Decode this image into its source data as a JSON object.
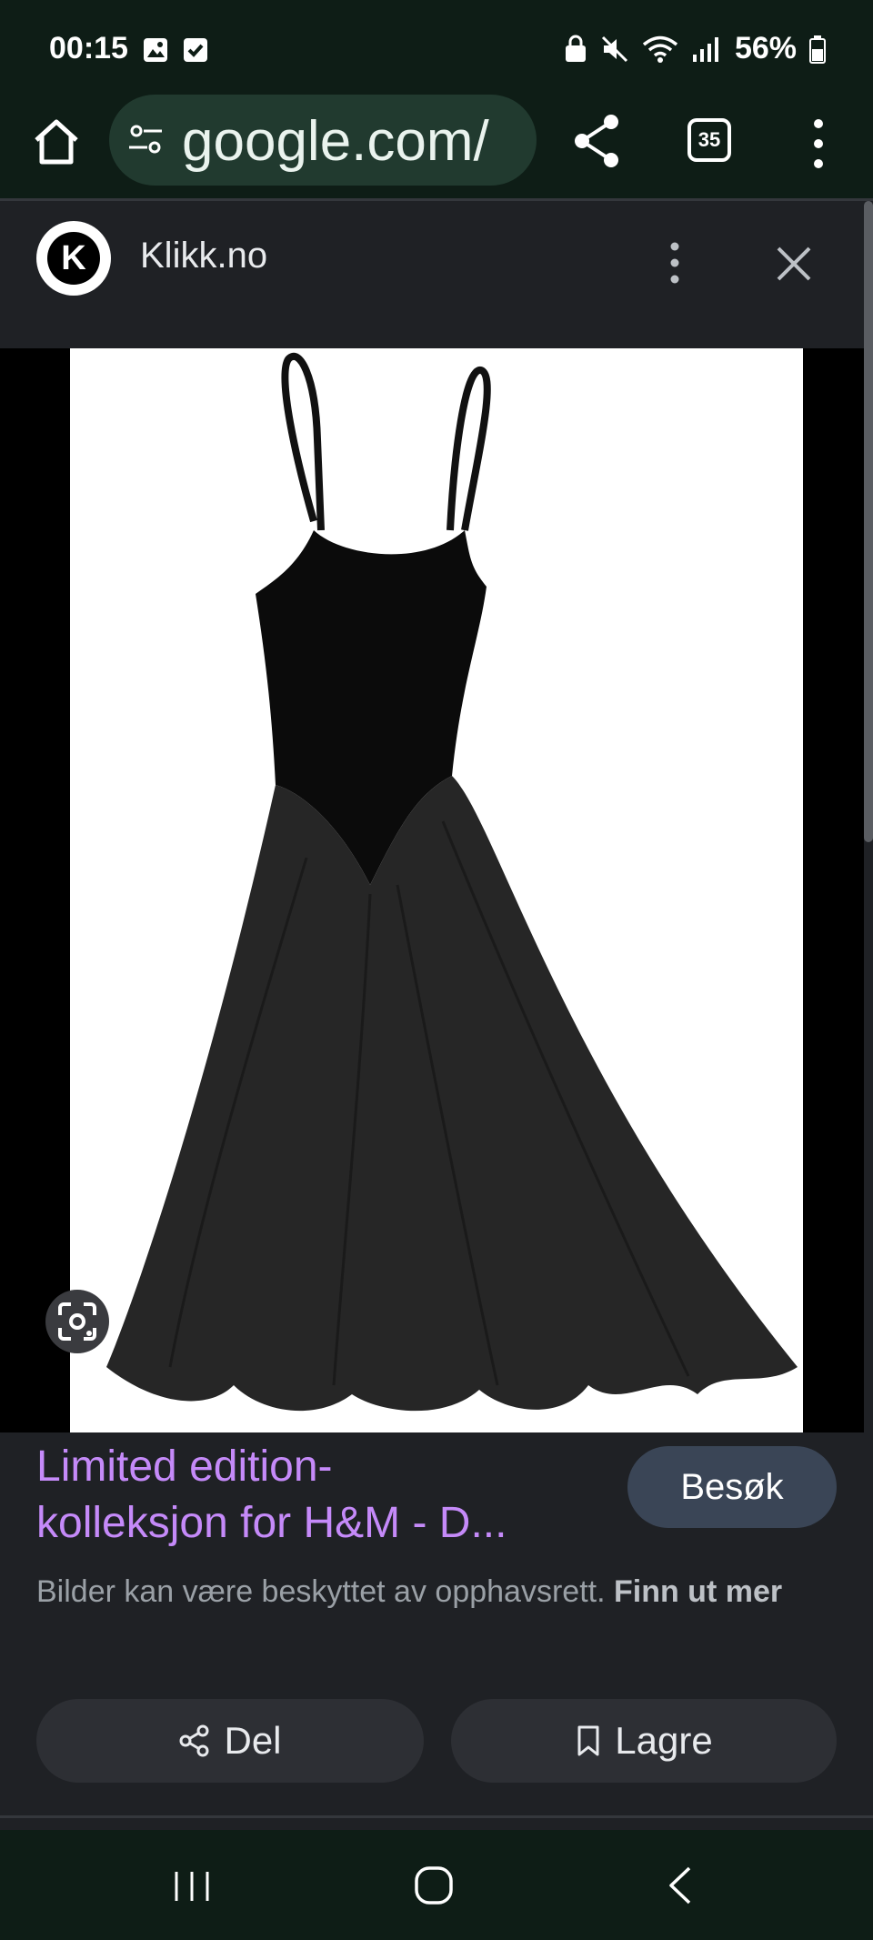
{
  "status_bar": {
    "time": "00:15",
    "battery": "56%",
    "icons": [
      "gallery-icon",
      "checkbox-icon",
      "nfc-lock-icon",
      "mute-icon",
      "wifi-icon",
      "signal-icon",
      "battery-icon"
    ]
  },
  "browser": {
    "url": "google.com/",
    "tab_count": "35",
    "icons": [
      "home-icon",
      "tune-icon",
      "share-icon",
      "more-vert-icon"
    ]
  },
  "source": {
    "logo_letter": "K",
    "name": "Klikk.no"
  },
  "result": {
    "title_line1": "Limited edition-",
    "title_line2": "kolleksjon for H&M - D...",
    "visit_label": "Besøk",
    "copyright_text": "Bilder kan være beskyttet av opphavsrett.",
    "learn_more": "Finn ut mer",
    "share_label": "Del",
    "save_label": "Lagre"
  },
  "colors": {
    "title_link": "#c58af9",
    "chrome_bg": "#0e1d16",
    "panel_bg": "#1f2125",
    "button_bg": "#2d2f34",
    "visit_bg": "#3a4556"
  }
}
